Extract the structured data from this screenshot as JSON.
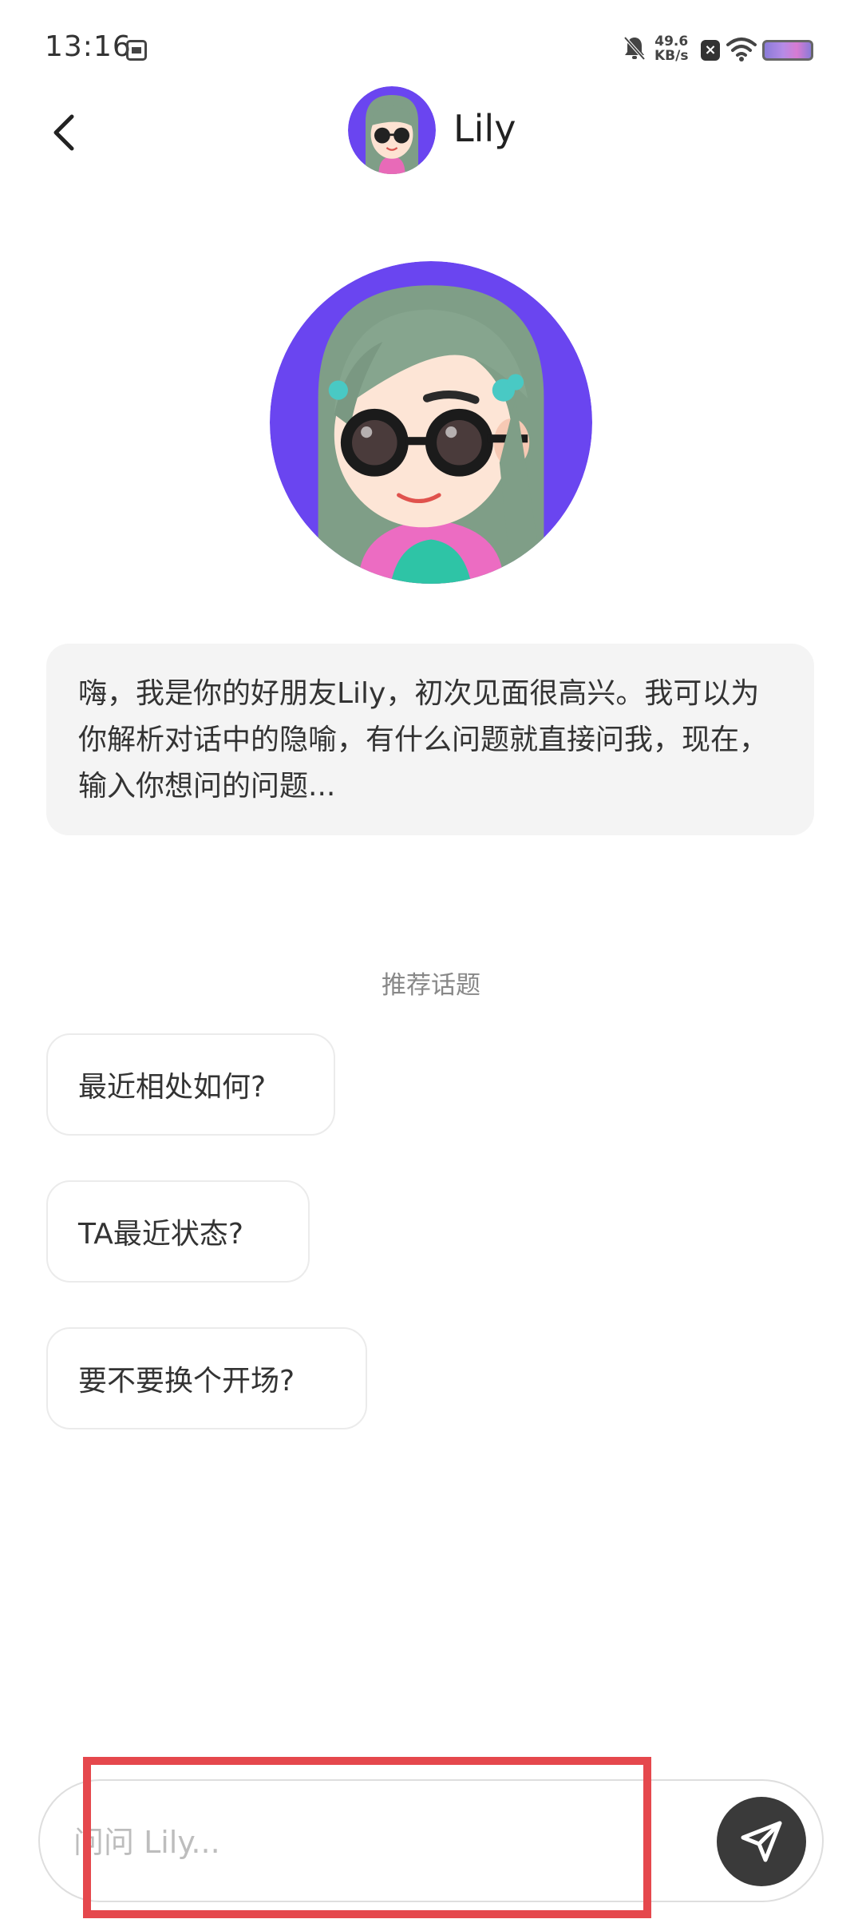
{
  "status_bar": {
    "time": "13:16",
    "net_speed_value": "49.6",
    "net_speed_unit": "KB/s",
    "icons": [
      "sim-icon",
      "mute-icon",
      "close-badge-icon",
      "wifi-icon",
      "battery-icon"
    ]
  },
  "header": {
    "back_icon": "chevron-left-icon",
    "name": "Lily"
  },
  "greeting": {
    "text": "嗨，我是你的好朋友Lily，初次见面很高兴。我可以为你解析对话中的隐喻，有什么问题就直接问我，现在，输入你想问的问题..."
  },
  "topics": {
    "title": "推荐话题",
    "items": [
      {
        "label": "最近相处如何?"
      },
      {
        "label": "TA最近状态?"
      },
      {
        "label": "要不要换个开场?"
      }
    ]
  },
  "composer": {
    "placeholder": "问问 Lily...",
    "value": "",
    "send_icon": "send-icon"
  },
  "colors": {
    "avatar_bg": "#6a45f0",
    "hair": "#7f9e87",
    "highlight": "#e5484d",
    "send_bg": "#3a3a3a"
  }
}
